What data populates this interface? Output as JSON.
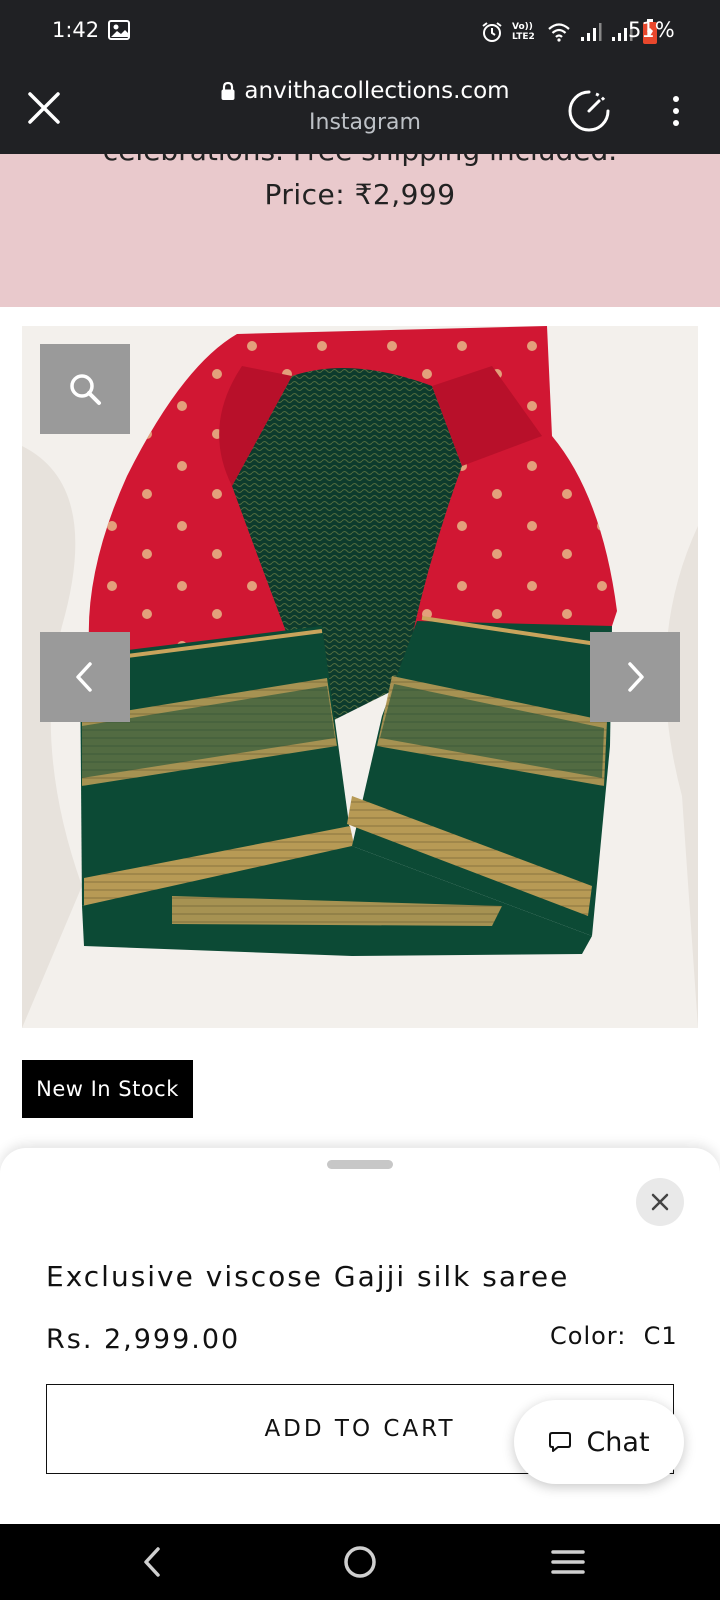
{
  "status_bar": {
    "time": "1:42",
    "battery_percent": "51%",
    "network_label": "Vo)) LTE2",
    "icons": [
      "gallery-icon",
      "alarm-icon",
      "wifi-icon",
      "signal-icon",
      "signal-icon",
      "battery-icon"
    ]
  },
  "browser": {
    "url": "anvithacollections.com",
    "source": "Instagram",
    "icons": [
      "close-icon",
      "lock-icon",
      "speed-icon",
      "more-vert-icon"
    ]
  },
  "banner": {
    "description": "celebrations. Free shipping included.",
    "price": "Price: ₹2,999"
  },
  "gallery": {
    "icons": [
      "search-icon",
      "chevron-left-icon",
      "chevron-right-icon"
    ]
  },
  "badge": {
    "label": "New In Stock"
  },
  "product": {
    "title": "Exclusive viscose Gajji silk saree",
    "price": "Rs. 2,999.00",
    "color_label": "Color:",
    "color_value": "C1",
    "add_to_cart_label": "ADD TO CART"
  },
  "chat": {
    "label": "Chat",
    "icon": "chat-bubble-icon"
  },
  "navigation": {
    "icons": [
      "back-icon",
      "home-icon",
      "recents-icon"
    ]
  },
  "colors": {
    "system_bar": "#202124",
    "banner_background": "#e9c9cc",
    "saree_red": "#d11733",
    "saree_green": "#0c4a35",
    "zari_gold": "#b79a55"
  }
}
